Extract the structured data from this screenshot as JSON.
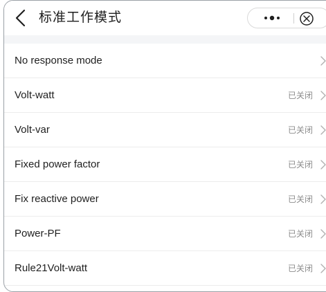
{
  "header": {
    "title": "标准工作模式",
    "back_icon": "chevron-left-icon",
    "more_icon": "more-dots-icon",
    "close_icon": "circle-close-icon"
  },
  "colors": {
    "text": "#1f1f1f",
    "status": "#8c8c8c",
    "divider": "#ececec",
    "band": "#f4f5f7"
  },
  "modes": [
    {
      "label": "No response mode",
      "status": ""
    },
    {
      "label": "Volt-watt",
      "status": "已关闭"
    },
    {
      "label": "Volt-var",
      "status": "已关闭"
    },
    {
      "label": "Fixed power factor",
      "status": "已关闭"
    },
    {
      "label": "Fix reactive power",
      "status": "已关闭"
    },
    {
      "label": "Power-PF",
      "status": "已关闭"
    },
    {
      "label": "Rule21Volt-watt",
      "status": "已关闭"
    }
  ]
}
